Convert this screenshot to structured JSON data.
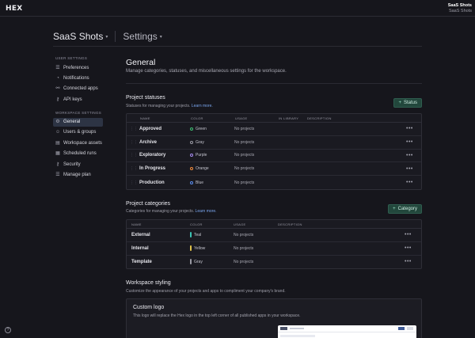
{
  "app": {
    "logo": "HEX"
  },
  "org": {
    "line1": "SaaS Shots",
    "line2": "SaaS Shots"
  },
  "breadcrumb": {
    "workspace": "SaaS Shots",
    "page": "Settings"
  },
  "sidebar": {
    "user_heading": "USER SETTINGS",
    "user_items": [
      {
        "label": "Preferences",
        "icon": "sliders-icon"
      },
      {
        "label": "Notifications",
        "icon": "bell-icon"
      },
      {
        "label": "Connected apps",
        "icon": "link-icon"
      },
      {
        "label": "API keys",
        "icon": "key-icon"
      }
    ],
    "workspace_heading": "WORKSPACE SETTINGS",
    "workspace_items": [
      {
        "label": "General",
        "icon": "gear-icon",
        "active": true
      },
      {
        "label": "Users & groups",
        "icon": "users-icon"
      },
      {
        "label": "Workspace assets",
        "icon": "assets-icon"
      },
      {
        "label": "Scheduled runs",
        "icon": "calendar-icon"
      },
      {
        "label": "Security",
        "icon": "key-icon"
      },
      {
        "label": "Manage plan",
        "icon": "sliders-icon"
      }
    ]
  },
  "page": {
    "title": "General",
    "subtitle": "Manage categories, statuses, and miscellaneous settings for the workspace."
  },
  "statuses": {
    "title": "Project statuses",
    "subtitle": "Statuses for managing your projects.",
    "learn_more": "Learn more.",
    "button": "Status",
    "columns": [
      "NAME",
      "COLOR",
      "USAGE",
      "IN LIBRARY",
      "DESCRIPTION"
    ],
    "rows": [
      {
        "name": "Approved",
        "color": "Green",
        "hex": "#3fbf73",
        "usage": "No projects"
      },
      {
        "name": "Archive",
        "color": "Gray",
        "hex": "#9a9aa4",
        "usage": "No projects"
      },
      {
        "name": "Exploratory",
        "color": "Purple",
        "hex": "#a78bf0",
        "usage": "No projects"
      },
      {
        "name": "In Progress",
        "color": "Orange",
        "hex": "#f08a3c",
        "usage": "No projects"
      },
      {
        "name": "Production",
        "color": "Blue",
        "hex": "#5a8dee",
        "usage": "No projects"
      }
    ]
  },
  "categories": {
    "title": "Project categories",
    "subtitle": "Categories for managing your projects.",
    "learn_more": "Learn more.",
    "button": "Category",
    "columns": [
      "NAME",
      "COLOR",
      "USAGE",
      "DESCRIPTION"
    ],
    "rows": [
      {
        "name": "External",
        "color": "Teal",
        "hex": "#3cc3b4",
        "usage": "No projects"
      },
      {
        "name": "Internal",
        "color": "Yellow",
        "hex": "#e0c24a",
        "usage": "No projects"
      },
      {
        "name": "Template",
        "color": "Gray",
        "hex": "#9a9aa4",
        "usage": "No projects"
      }
    ]
  },
  "styling": {
    "title": "Workspace styling",
    "subtitle": "Customize the appearance of your projects and apps to compliment your company's brand.",
    "logo_title": "Custom logo",
    "logo_sub": "This logo will replace the Hex logo in the top left corner of all published apps in your workspace."
  },
  "help": {
    "label": "?"
  }
}
